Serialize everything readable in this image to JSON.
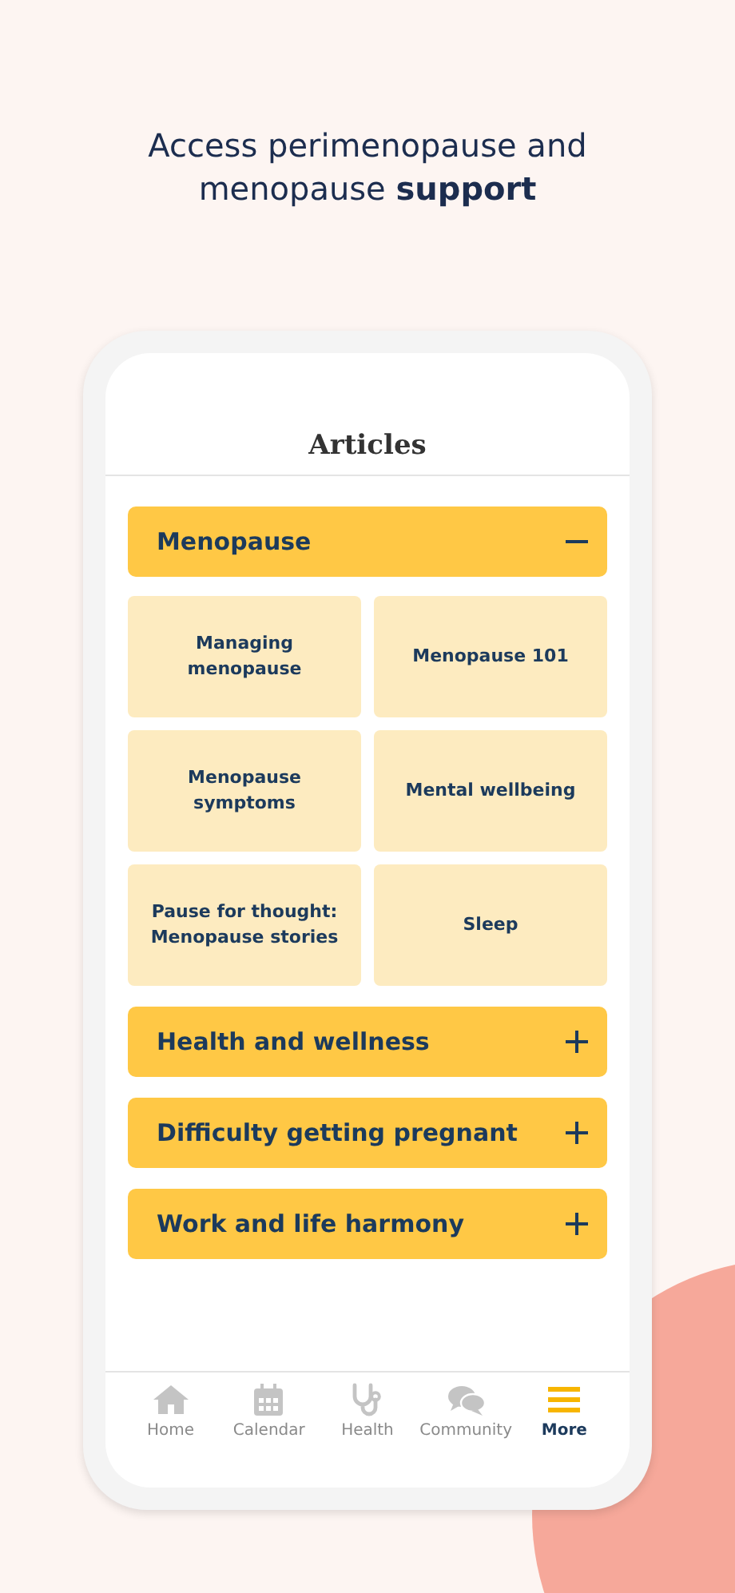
{
  "headline": "Access perimenopause and menopause **support**",
  "screen_title": "Articles",
  "sections": [
    {
      "title": "Menopause",
      "expanded": true,
      "articles": [
        "Managing menopause",
        "Menopause 101",
        "Menopause symptoms",
        "Mental wellbeing",
        "Pause for thought: Menopause stories",
        "Sleep"
      ]
    },
    {
      "title": "Health and wellness",
      "expanded": false
    },
    {
      "title": "Difficulty getting pregnant",
      "expanded": false
    },
    {
      "title": "Work and life harmony",
      "expanded": false
    }
  ],
  "nav": [
    {
      "label": "Home",
      "kind": "home",
      "selected": false
    },
    {
      "label": "Calendar",
      "kind": "calendar",
      "selected": false
    },
    {
      "label": "Health",
      "kind": "health",
      "selected": false
    },
    {
      "label": "Community",
      "kind": "community",
      "selected": false
    },
    {
      "label": "More",
      "kind": "more",
      "selected": true
    }
  ]
}
